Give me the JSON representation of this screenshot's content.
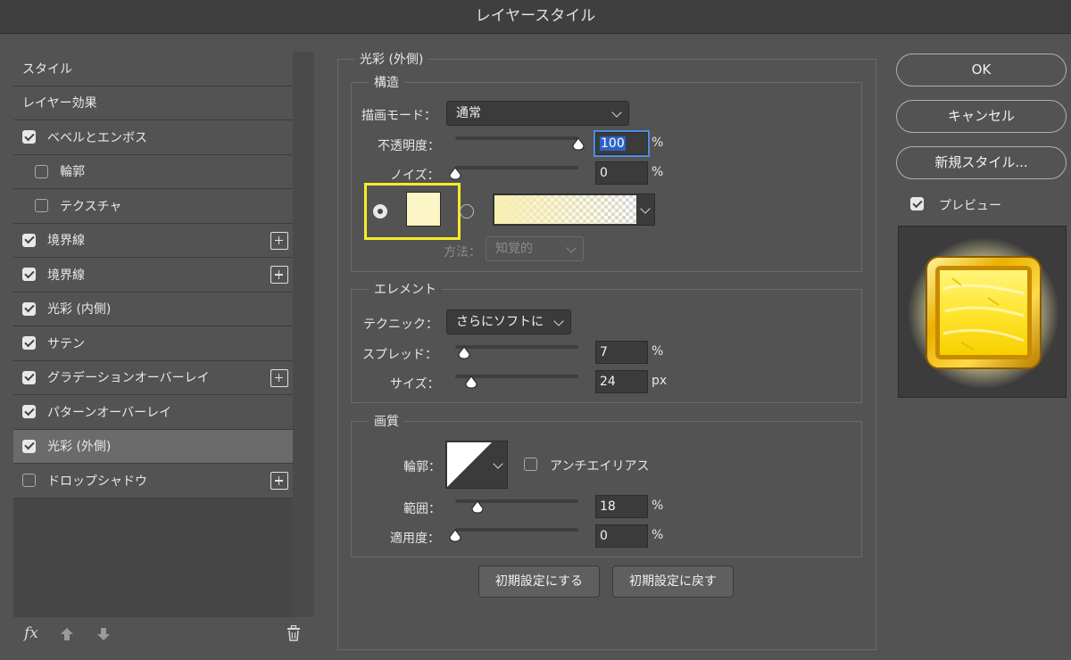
{
  "window": {
    "title": "レイヤースタイル"
  },
  "styles": [
    {
      "label": "スタイル",
      "checkbox": null,
      "indent": false,
      "plus": false,
      "selected": false
    },
    {
      "label": "レイヤー効果",
      "checkbox": null,
      "indent": false,
      "plus": false,
      "selected": false
    },
    {
      "label": "ベベルとエンボス",
      "checkbox": true,
      "indent": false,
      "plus": false,
      "selected": false
    },
    {
      "label": "輪郭",
      "checkbox": false,
      "indent": true,
      "plus": false,
      "selected": false
    },
    {
      "label": "テクスチャ",
      "checkbox": false,
      "indent": true,
      "plus": false,
      "selected": false
    },
    {
      "label": "境界線",
      "checkbox": true,
      "indent": false,
      "plus": true,
      "selected": false
    },
    {
      "label": "境界線",
      "checkbox": true,
      "indent": false,
      "plus": true,
      "selected": false
    },
    {
      "label": "光彩 (内側)",
      "checkbox": true,
      "indent": false,
      "plus": false,
      "selected": false
    },
    {
      "label": "サテン",
      "checkbox": true,
      "indent": false,
      "plus": false,
      "selected": false
    },
    {
      "label": "グラデーションオーバーレイ",
      "checkbox": true,
      "indent": false,
      "plus": true,
      "selected": false
    },
    {
      "label": "パターンオーバーレイ",
      "checkbox": true,
      "indent": false,
      "plus": false,
      "selected": false
    },
    {
      "label": "光彩 (外側)",
      "checkbox": true,
      "indent": false,
      "plus": false,
      "selected": true
    },
    {
      "label": "ドロップシャドウ",
      "checkbox": false,
      "indent": false,
      "plus": true,
      "selected": false
    }
  ],
  "footer": {
    "fx": "fx"
  },
  "panel": {
    "title": "光彩 (外側)",
    "structure": {
      "title": "構造",
      "blend_mode_label": "描画モード：",
      "blend_mode_value": "通常",
      "opacity_label": "不透明度：",
      "opacity_value": "100",
      "opacity_unit": "%",
      "opacity_fraction": 1.0,
      "noise_label": "ノイズ：",
      "noise_value": "0",
      "noise_unit": "%",
      "noise_fraction": 0.0,
      "color_swatch": "#fcf5c5",
      "color_mode": "solid",
      "method_label": "方法：",
      "method_value": "知覚的"
    },
    "elements": {
      "title": "エレメント",
      "technique_label": "テクニック：",
      "technique_value": "さらにソフトに",
      "spread_label": "スプレッド：",
      "spread_value": "7",
      "spread_unit": "%",
      "spread_fraction": 0.07,
      "size_label": "サイズ：",
      "size_value": "24",
      "size_unit": "px",
      "size_fraction": 0.13
    },
    "quality": {
      "title": "画質",
      "contour_label": "輪郭：",
      "antialias_label": "アンチエイリアス",
      "antialias_checked": false,
      "range_label": "範囲：",
      "range_value": "18",
      "range_unit": "%",
      "range_fraction": 0.18,
      "jitter_label": "適用度：",
      "jitter_value": "0",
      "jitter_unit": "%",
      "jitter_fraction": 0.0
    },
    "buttons": {
      "make_default": "初期設定にする",
      "reset_default": "初期設定に戻す"
    }
  },
  "right": {
    "ok": "OK",
    "cancel": "キャンセル",
    "new_style": "新規スタイル...",
    "preview_label": "プレビュー",
    "preview_checked": true
  }
}
